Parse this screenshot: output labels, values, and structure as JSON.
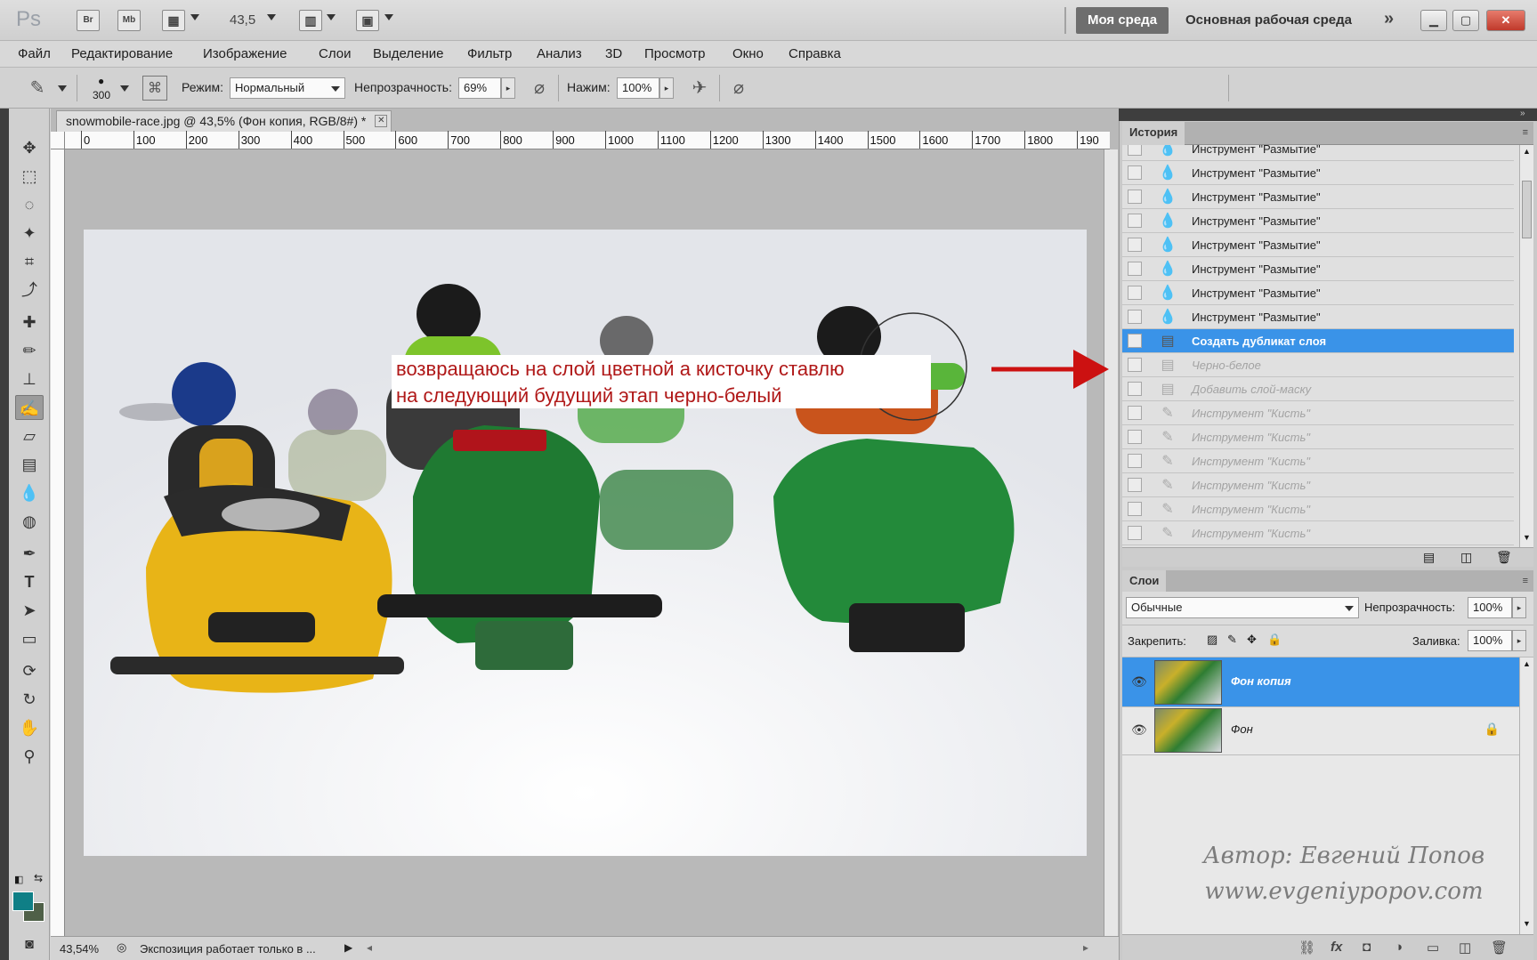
{
  "titlebar": {
    "app_logo": "Ps",
    "bridge_label": "Br",
    "minibridge_label": "Mb",
    "zoom": "43,5",
    "workspace_active": "Моя среда",
    "workspace_main": "Основная рабочая среда",
    "more_glyph": "»"
  },
  "menu": [
    "Файл",
    "Редактирование",
    "Изображение",
    "Слои",
    "Выделение",
    "Фильтр",
    "Анализ",
    "3D",
    "Просмотр",
    "Окно",
    "Справка"
  ],
  "options": {
    "brush_size": "300",
    "mode_label": "Режим:",
    "mode_value": "Нормальный",
    "opacity_label": "Непрозрачность:",
    "opacity_value": "69%",
    "pressure_label": "Нажим:",
    "pressure_value": "100%"
  },
  "document": {
    "tab_title": "snowmobile-race.jpg @ 43,5% (Фон копия, RGB/8#) *",
    "ruler_ticks": [
      "0",
      "100",
      "200",
      "300",
      "400",
      "500",
      "600",
      "700",
      "800",
      "900",
      "1000",
      "1100",
      "1200",
      "1300",
      "1400",
      "1500",
      "1600",
      "1700",
      "1800",
      "190"
    ],
    "caption_line1": "возвращаюсь на слой цветной а кисточку ставлю",
    "caption_line2": "на следующий будущий этап черно-белый"
  },
  "status": {
    "zoom": "43,54%",
    "message": "Экспозиция работает только в ..."
  },
  "history": {
    "title": "История",
    "items": [
      {
        "label": "Инструмент \"Размытие\"",
        "icon": "drop-icon",
        "state": "normal"
      },
      {
        "label": "Инструмент \"Размытие\"",
        "icon": "drop-icon",
        "state": "normal"
      },
      {
        "label": "Инструмент \"Размытие\"",
        "icon": "drop-icon",
        "state": "normal"
      },
      {
        "label": "Инструмент \"Размытие\"",
        "icon": "drop-icon",
        "state": "normal"
      },
      {
        "label": "Инструмент \"Размытие\"",
        "icon": "drop-icon",
        "state": "normal"
      },
      {
        "label": "Инструмент \"Размытие\"",
        "icon": "drop-icon",
        "state": "normal"
      },
      {
        "label": "Инструмент \"Размытие\"",
        "icon": "drop-icon",
        "state": "normal"
      },
      {
        "label": "Инструмент \"Размытие\"",
        "icon": "drop-icon",
        "state": "normal"
      },
      {
        "label": "Создать дубликат слоя",
        "icon": "layer-doc-icon",
        "state": "selected"
      },
      {
        "label": "Черно-белое",
        "icon": "layer-doc-icon",
        "state": "dim"
      },
      {
        "label": "Добавить слой-маску",
        "icon": "layer-doc-icon",
        "state": "dim"
      },
      {
        "label": "Инструмент \"Кисть\"",
        "icon": "brush-icon",
        "state": "dim"
      },
      {
        "label": "Инструмент \"Кисть\"",
        "icon": "brush-icon",
        "state": "dim"
      },
      {
        "label": "Инструмент \"Кисть\"",
        "icon": "brush-icon",
        "state": "dim"
      },
      {
        "label": "Инструмент \"Кисть\"",
        "icon": "brush-icon",
        "state": "dim"
      },
      {
        "label": "Инструмент \"Кисть\"",
        "icon": "brush-icon",
        "state": "dim"
      },
      {
        "label": "Инструмент \"Кисть\"",
        "icon": "brush-icon",
        "state": "dim"
      }
    ]
  },
  "layers": {
    "title": "Слои",
    "blend_mode": "Обычные",
    "opacity_label": "Непрозрачность:",
    "opacity_value": "100%",
    "lock_label": "Закрепить:",
    "fill_label": "Заливка:",
    "fill_value": "100%",
    "items": [
      {
        "name": "Фон копия",
        "selected": true,
        "locked": false
      },
      {
        "name": "Фон",
        "selected": false,
        "locked": true
      }
    ]
  },
  "watermark": {
    "line1": "Автор: Евгений Попов",
    "line2": "www.evgeniypopov.com"
  },
  "colors": {
    "foreground": "#0f7f86",
    "background": "#4f6048",
    "selection": "#3a93e8",
    "caption_text": "#b01818",
    "arrow": "#cc1111"
  }
}
